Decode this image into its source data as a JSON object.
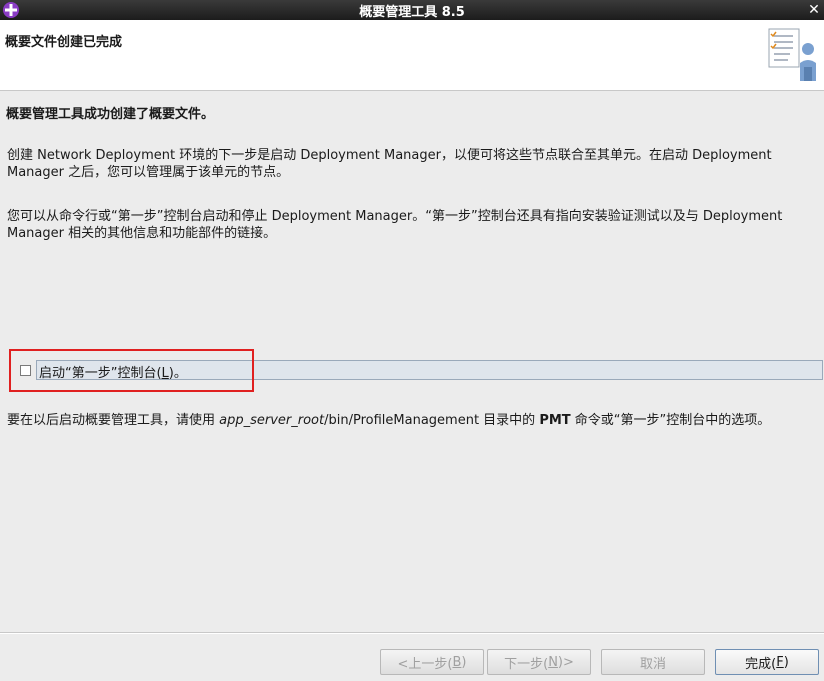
{
  "window": {
    "title": "概要管理工具 8.5",
    "close_glyph": "✕"
  },
  "header": {
    "title": "概要文件创建已完成",
    "image_icon": "document-person-icon"
  },
  "content": {
    "success_message": "概要管理工具成功创建了概要文件。",
    "paragraph1": "创建 Network Deployment 环境的下一步是启动 Deployment Manager，以便可将这些节点联合至其单元。在启动 Deployment Manager 之后，您可以管理属于该单元的节点。",
    "paragraph2": "您可以从命令行或“第一步”控制台启动和停止 Deployment Manager。“第一步”控制台还具有指向安装验证测试以及与 Deployment Manager 相关的其他信息和功能部件的链接。",
    "launch_checkbox": {
      "label_before": "启动“第一步”控制台(",
      "mnemonic": "L",
      "label_after": ")。",
      "checked": false
    },
    "paragraph3": {
      "part1": "要在以后启动概要管理工具，请使用 ",
      "path_italic": "app_server_root",
      "part2": "/bin/ProfileManagement 目录中的 ",
      "command_bold": "PMT",
      "part3": " 命令或“第一步”控制台中的选项。"
    }
  },
  "buttons": {
    "back": {
      "before": "<上一步(",
      "mnemonic": "B",
      "after": ")"
    },
    "next": {
      "before": "下一步(",
      "mnemonic": "N",
      "after": ")>"
    },
    "cancel": {
      "label": "取消"
    },
    "finish": {
      "before": "完成(",
      "mnemonic": "F",
      "after": ")"
    }
  },
  "colors": {
    "highlight": "#e02020",
    "title_bar": "#2a2a2a",
    "selected_row": "#dfe5ec"
  }
}
